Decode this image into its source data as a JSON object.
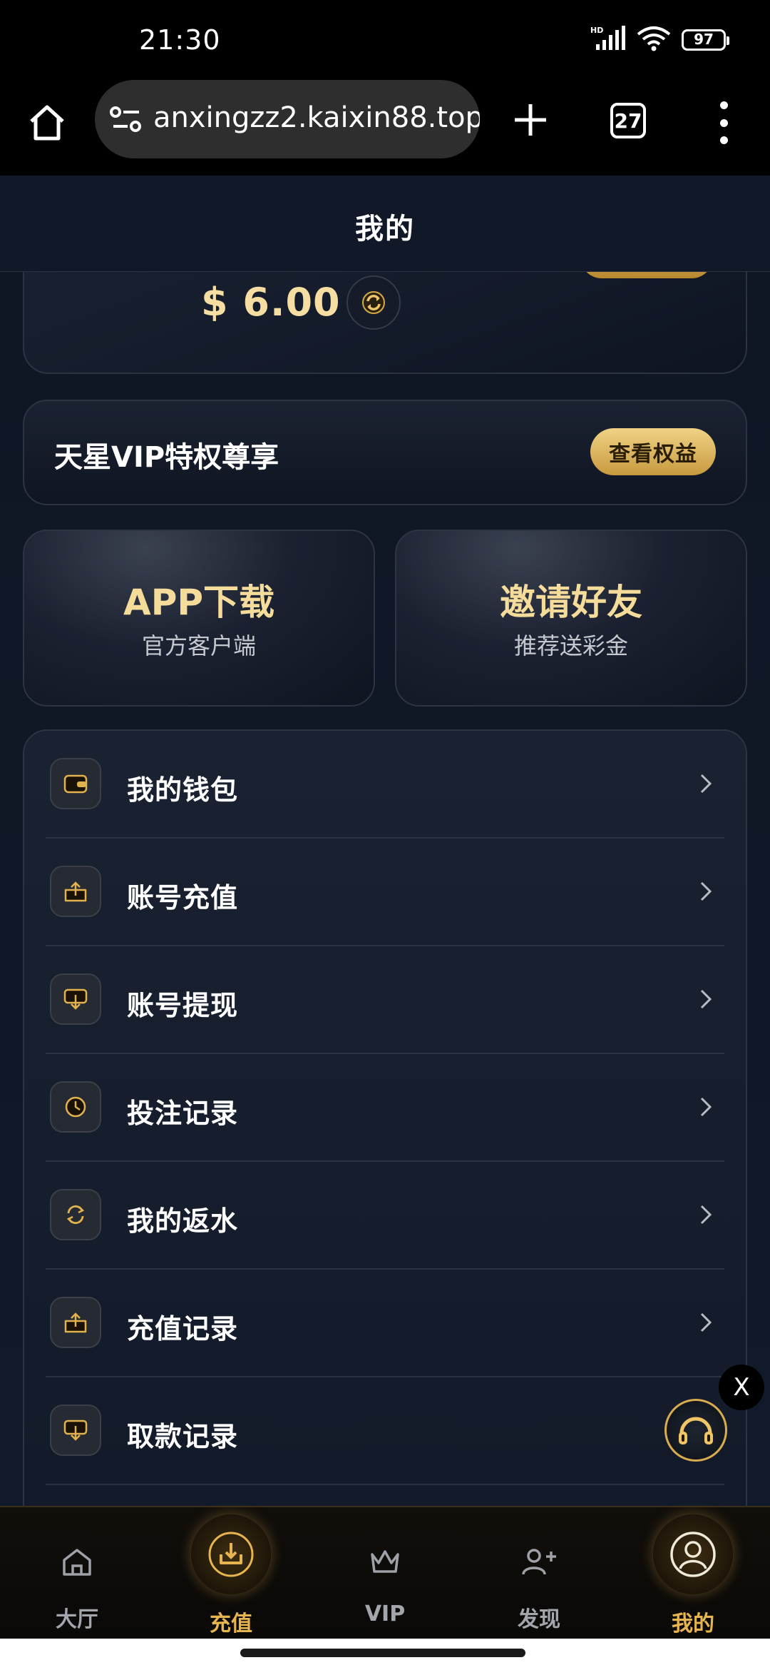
{
  "status_bar": {
    "time": "21:30",
    "battery": "97",
    "network_label": "HD"
  },
  "browser": {
    "url": "anxingzz2.kaixin88.top",
    "tab_count": "27"
  },
  "header": {
    "title": "我的"
  },
  "profile": {
    "balance": "$ 6.00"
  },
  "vip_banner": {
    "title": "天星VIP特权尊享",
    "button_label": "查看权益"
  },
  "features": [
    {
      "title": "APP下载",
      "subtitle": "官方客户端"
    },
    {
      "title": "邀请好友",
      "subtitle": "推荐送彩金"
    }
  ],
  "menu": {
    "items": [
      {
        "label": "我的钱包",
        "icon": "wallet-icon"
      },
      {
        "label": "账号充值",
        "icon": "upload-tray-icon"
      },
      {
        "label": "账号提现",
        "icon": "withdraw-tray-icon"
      },
      {
        "label": "投注记录",
        "icon": "clock-icon"
      },
      {
        "label": "我的返水",
        "icon": "refresh-icon"
      },
      {
        "label": "充值记录",
        "icon": "upload-tray-icon"
      },
      {
        "label": "取款记录",
        "icon": "withdraw-tray-icon"
      }
    ]
  },
  "floating": {
    "close_label": "X"
  },
  "bottom_nav": {
    "items": [
      {
        "label": "大厅",
        "icon": "home-icon"
      },
      {
        "label": "充值",
        "icon": "deposit-icon"
      },
      {
        "label": "VIP",
        "icon": "crown-icon"
      },
      {
        "label": "发现",
        "icon": "add-user-icon"
      },
      {
        "label": "我的",
        "icon": "user-icon"
      }
    ],
    "active_index": 4
  },
  "colors": {
    "gold": "#e7b550",
    "background": "#0d1320",
    "card": "#1a2232"
  }
}
